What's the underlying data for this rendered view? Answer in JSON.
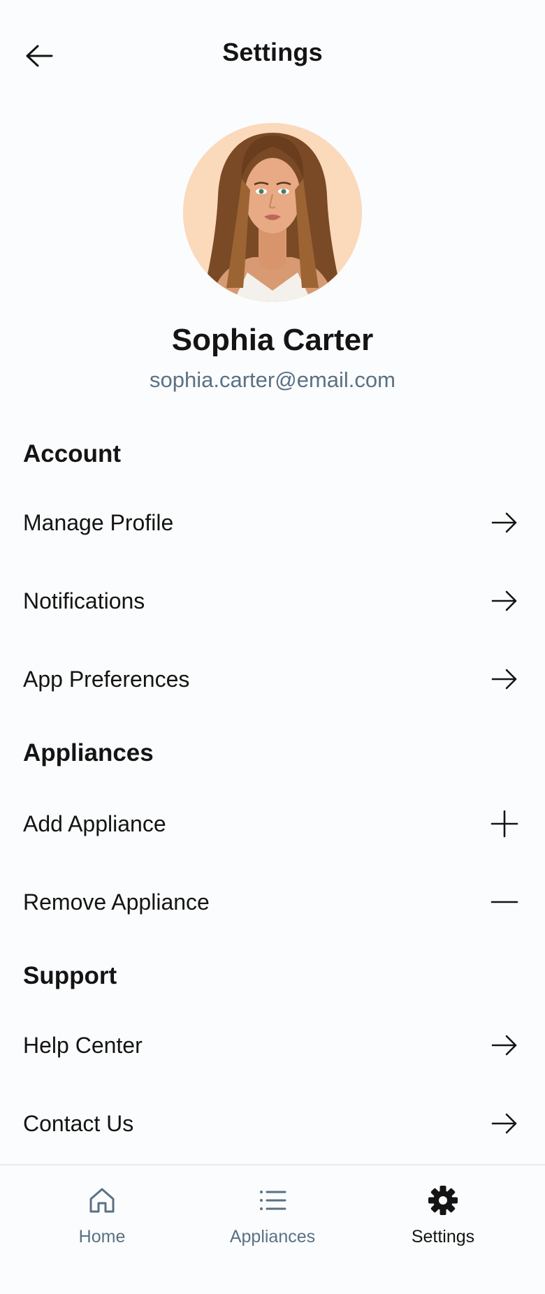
{
  "header": {
    "title": "Settings",
    "back_icon": "arrow-left-icon"
  },
  "profile": {
    "name": "Sophia Carter",
    "email": "sophia.carter@email.com"
  },
  "sections": {
    "account": {
      "title": "Account",
      "items": [
        {
          "label": "Manage Profile",
          "icon": "arrow-right-icon"
        },
        {
          "label": "Notifications",
          "icon": "arrow-right-icon"
        },
        {
          "label": "App Preferences",
          "icon": "arrow-right-icon"
        }
      ]
    },
    "appliances": {
      "title": "Appliances",
      "items": [
        {
          "label": "Add Appliance",
          "icon": "plus-icon"
        },
        {
          "label": "Remove Appliance",
          "icon": "minus-icon"
        }
      ]
    },
    "support": {
      "title": "Support",
      "items": [
        {
          "label": "Help Center",
          "icon": "arrow-right-icon"
        },
        {
          "label": "Contact Us",
          "icon": "arrow-right-icon"
        }
      ]
    }
  },
  "bottom_nav": {
    "items": [
      {
        "label": "Home",
        "icon": "home-icon",
        "active": false
      },
      {
        "label": "Appliances",
        "icon": "list-icon",
        "active": false
      },
      {
        "label": "Settings",
        "icon": "gear-icon",
        "active": true
      }
    ]
  },
  "colors": {
    "text_primary": "#141414",
    "text_secondary": "#5a7184",
    "avatar_bg": "#fbd9bb",
    "divider": "#e8ecef"
  }
}
